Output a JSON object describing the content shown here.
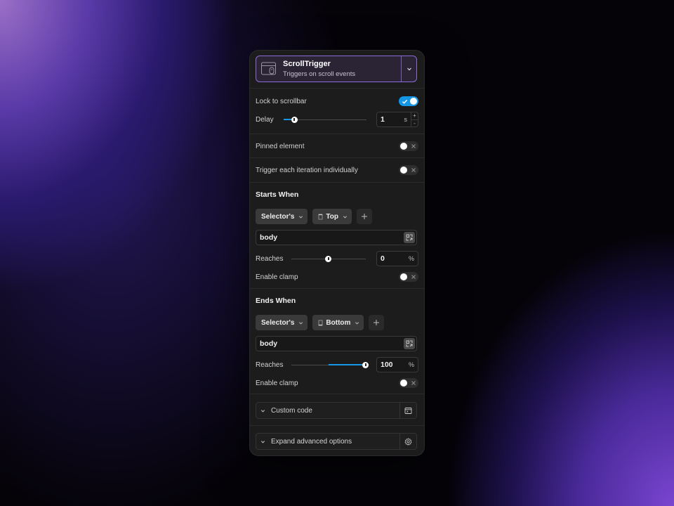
{
  "trigger": {
    "title": "ScrollTrigger",
    "subtitle": "Triggers on scroll events"
  },
  "lock": {
    "label": "Lock to scrollbar",
    "enabled": true
  },
  "delay": {
    "label": "Delay",
    "value": "1",
    "unit": "s",
    "slider_fraction": 0.13,
    "inc": "+",
    "dec": "-"
  },
  "pinned": {
    "label": "Pinned element",
    "enabled": false
  },
  "iteration": {
    "label": "Trigger each iteration individually",
    "enabled": false
  },
  "starts": {
    "heading": "Starts When",
    "selector_label": "Selector's",
    "position_label": "Top",
    "selector_value": "body",
    "reaches_label": "Reaches",
    "reaches_value": "0",
    "reaches_unit": "%",
    "reaches_fraction": 0.5,
    "clamp_label": "Enable clamp",
    "clamp_enabled": false
  },
  "ends": {
    "heading": "Ends When",
    "selector_label": "Selector's",
    "position_label": "Bottom",
    "selector_value": "body",
    "reaches_label": "Reaches",
    "reaches_value": "100",
    "reaches_unit": "%",
    "reaches_fraction": 1.0,
    "fill_start_fraction": 0.5,
    "clamp_label": "Enable clamp",
    "clamp_enabled": false
  },
  "custom_code": {
    "label": "Custom code"
  },
  "advanced": {
    "label": "Expand advanced options"
  },
  "colors": {
    "accent": "#1597e5",
    "trigger_border": "#8a6ad8",
    "panel_bg": "#1c1c1c"
  }
}
